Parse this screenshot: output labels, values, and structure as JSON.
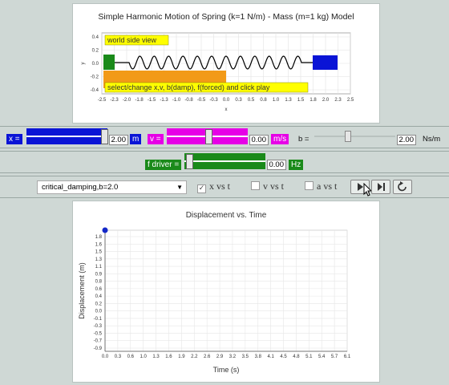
{
  "sim": {
    "title": "Simple Harmonic Motion of Spring (k=1 N/m) - Mass (m=1 kg) Model",
    "tag_world": "world side view",
    "tag_hint": "select/change x,v, b(damp), f(forced) and click play",
    "xlabel": "x",
    "ylabel": "y",
    "x_ticks": [
      "-2.5",
      "-2.3",
      "-2.0",
      "-1.8",
      "-1.5",
      "-1.3",
      "-1.0",
      "-0.8",
      "-0.5",
      "-0.3",
      "0.0",
      "0.3",
      "0.5",
      "0.8",
      "1.0",
      "1.3",
      "1.5",
      "1.8",
      "2.0",
      "2.3",
      "2.5"
    ],
    "y_ticks": [
      "0.4",
      "0.2",
      "0.0",
      "-0.2",
      "-0.4"
    ],
    "colors": {
      "wall": "#1a8a1a",
      "mass": "#0a14d6",
      "orange": "#f29a18",
      "tag": "#ffff00"
    }
  },
  "controls": {
    "x_label": "x =",
    "x_value": "2.00",
    "x_unit": "m",
    "v_label": "v =",
    "v_value": "0.00",
    "v_unit": "m/s",
    "b_label": "b =",
    "b_value": "2.00",
    "b_unit": "Ns/m",
    "f_label": "f driver =",
    "f_value": "0.00",
    "f_unit": "Hz",
    "damping_select": "critical_damping,b=2.0",
    "cb_xvt": {
      "label": "x vs t",
      "checked": true
    },
    "cb_vvt": {
      "label": "v vs t",
      "checked": false
    },
    "cb_avt": {
      "label": "a vs t",
      "checked": false
    }
  },
  "icons": {
    "play": "play-icon",
    "step": "step-icon",
    "reset": "reset-icon",
    "dropdown": "chevron-down-icon",
    "cursor": "cursor-pointer-icon"
  },
  "graph": {
    "chart_data": {
      "type": "scatter",
      "title": "Displacement vs. Time",
      "xlabel": "Time (s)",
      "ylabel": "Displacement (m)",
      "xlim": [
        0.0,
        6.1
      ],
      "ylim": [
        -0.9,
        1.8
      ],
      "x_ticks": [
        "0.0",
        "0.3",
        "0.6",
        "1.0",
        "1.3",
        "1.6",
        "1.9",
        "2.2",
        "2.6",
        "2.9",
        "3.2",
        "3.5",
        "3.8",
        "4.1",
        "4.5",
        "4.8",
        "5.1",
        "5.4",
        "5.7",
        "6.1"
      ],
      "y_ticks": [
        "1.8",
        "1.6",
        "1.5",
        "1.3",
        "1.1",
        "0.9",
        "0.8",
        "0.6",
        "0.4",
        "0.2",
        "0.0",
        "-0.1",
        "-0.3",
        "-0.5",
        "-0.7",
        "-0.9"
      ],
      "grid": true,
      "points": [
        {
          "x": 0.0,
          "y": 2.0
        }
      ]
    }
  }
}
